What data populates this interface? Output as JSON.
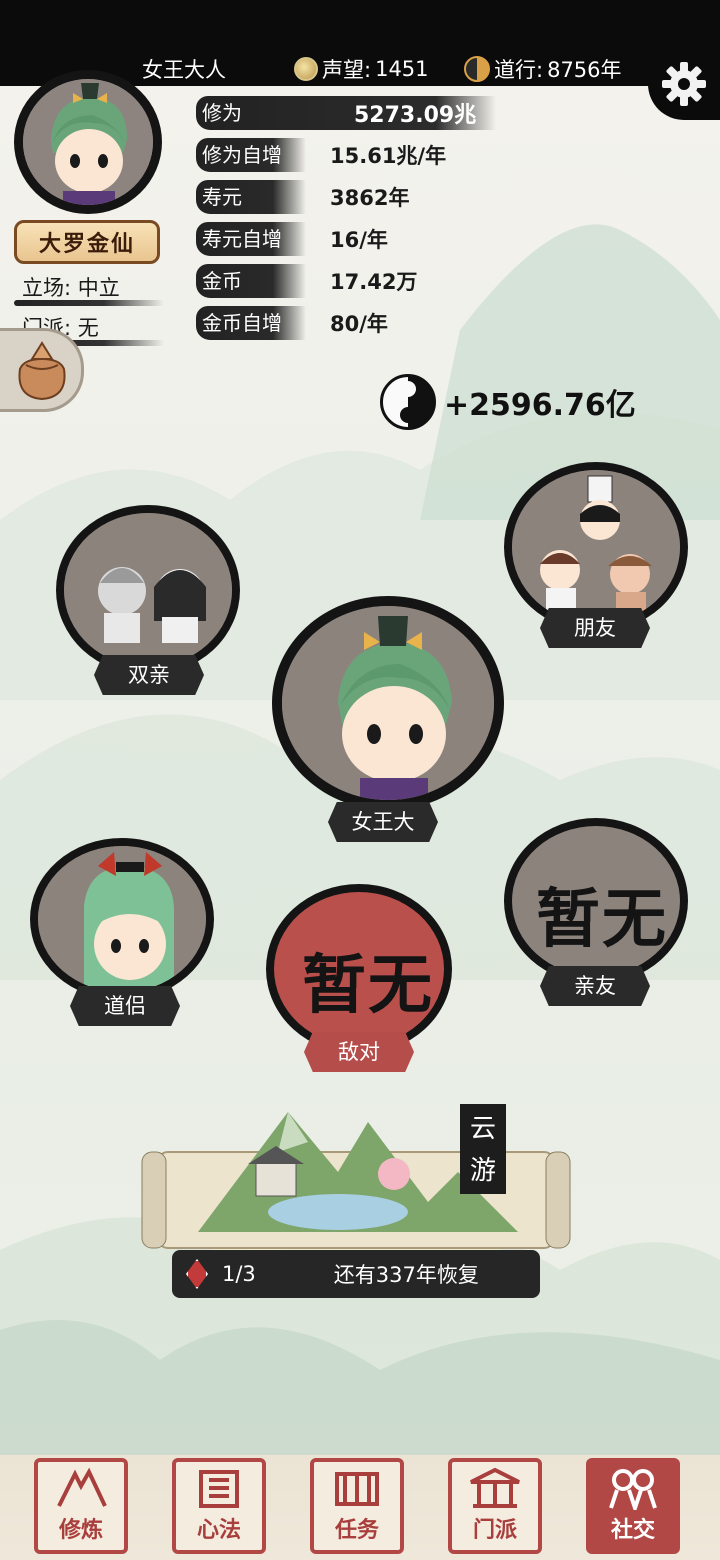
{
  "header": {
    "player_name": "女王大人",
    "reputation_label": "声望:",
    "reputation_value": "1451",
    "daoxing_label": "道行:",
    "daoxing_value": "8756年"
  },
  "profile": {
    "rank_badge": "大罗金仙",
    "stance": "立场: 中立",
    "sect": "门派: 无"
  },
  "stats": [
    {
      "label": "修为",
      "value": "5273.09兆"
    },
    {
      "label": "修为自增",
      "value": "15.61兆/年"
    },
    {
      "label": "寿元",
      "value": "3862年"
    },
    {
      "label": "寿元自增",
      "value": "16/年"
    },
    {
      "label": "金币",
      "value": "17.42万"
    },
    {
      "label": "金币自增",
      "value": "80/年"
    }
  ],
  "gain": "+2596.76亿",
  "relations": {
    "parents": "双亲",
    "friends": "朋友",
    "self": "女王大人",
    "partner": "道侣",
    "enemy": "敌对",
    "enemy_empty": "暂无",
    "relatives": "亲友",
    "relatives_empty": "暂无"
  },
  "travel": {
    "label": "云游",
    "count": "1/3",
    "recover": "还有337年恢复"
  },
  "nav": [
    {
      "label": "修炼"
    },
    {
      "label": "心法"
    },
    {
      "label": "任务"
    },
    {
      "label": "门派"
    },
    {
      "label": "社交"
    }
  ],
  "colors": {
    "accent_red": "#b24846",
    "ink": "#141414",
    "disc_grey": "#8c837d"
  }
}
